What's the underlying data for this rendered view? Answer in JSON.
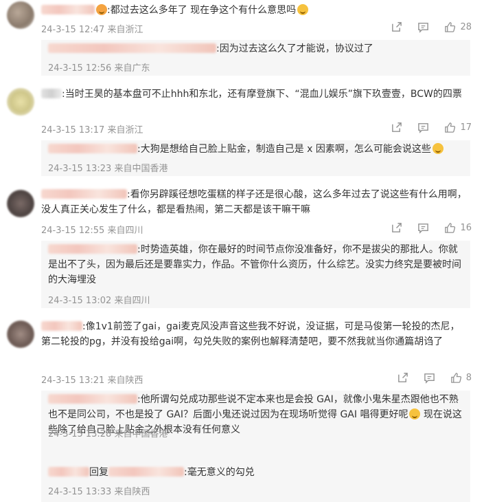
{
  "comments": [
    {
      "text": ":都过去这么多年了 现在争这个有什么意思吗",
      "date": "24-3-15 12:47",
      "location": "来自浙江",
      "likes": "28",
      "replies": [
        {
          "text": ":因为过去这么久了才能说，协议过了",
          "date": "24-3-15 12:56",
          "location": "来自广东"
        }
      ]
    },
    {
      "text": ":当时王昊的基本盘可不止hhh和东北，还有摩登旗下、“混血儿娱乐”旗下玖壹壹，BCW的四票",
      "date": "24-3-15 13:17",
      "location": "来自浙江",
      "likes": "17",
      "replies": [
        {
          "text": ":大狗是想给自己脸上贴金，制造自己是 x 因素啊，怎么可能会说这些",
          "date": "24-3-15 13:23",
          "location": "来自中国香港"
        }
      ]
    },
    {
      "text": ":看你另辟蹊径想吃蛋糕的样子还是很心酸，这么多年过去了说这些有什么用啊，没人真正关心发生了什么，都是看热闹，第二天都是该干嘛干嘛",
      "date": "24-3-15 12:55",
      "location": "来自四川",
      "likes": "16",
      "replies": [
        {
          "text": ":时势造英雄，你在最好的时间节点你没准备好，你不是拔尖的那批人。你就是出不了头，因为最后还是要靠实力，作品。不管你什么资历，什么综艺。没实力终究是要被时间的大海埋没",
          "date": "24-3-15 13:02",
          "location": "来自四川"
        }
      ]
    },
    {
      "text": ":像1v1前签了gai，gai麦克风没声音这些我不好说，没证据，可是马俊第一轮投的杰尼，第二轮投的pg，并没有投给gai啊，勾兑失败的案例也解释清楚吧，要不然我就当你通篇胡诌了",
      "date": "24-3-15 13:21",
      "location": "来自陕西",
      "likes": "8",
      "replies": [
        {
          "text": ":他所谓勾兑成功那些说不定本来也是会投 GAI，就像小鬼朱星杰跟他也不熟也不是同公司，不也是投了 GAI？后面小鬼还说过因为在现场听觉得 GAI 唱得更好呢",
          "text2": " 现在说这些除了给自己脸上贴金之外根本没有任何意义",
          "date": "24-3-15 13:28",
          "location": "来自中国香港"
        },
        {
          "prefix": "回复",
          "text": ":毫无意义的勾兑",
          "date": "24-3-15 13:33",
          "location": "来自陕西"
        }
      ]
    }
  ],
  "icons": {
    "share": "share-icon",
    "comment": "comment-icon",
    "like": "like-icon"
  }
}
